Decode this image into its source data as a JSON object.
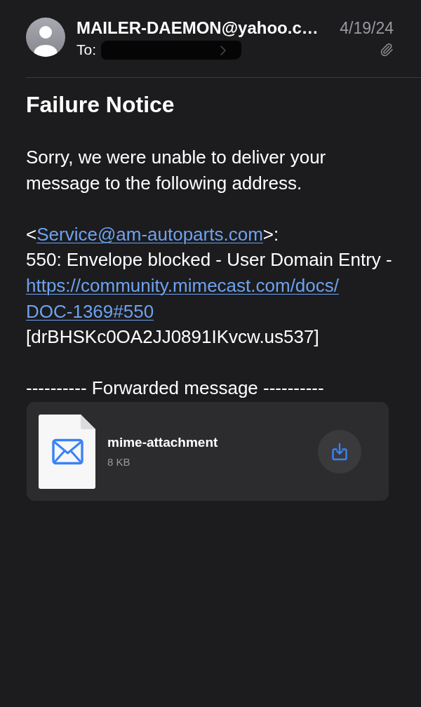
{
  "header": {
    "sender": "MAILER-DAEMON@yahoo.c…",
    "date": "4/19/24",
    "to": {
      "label": "To:",
      "redacted": true
    },
    "has_attachment": true
  },
  "subject": "Failure Notice",
  "body": [
    {
      "lines": [
        {
          "kind": "text",
          "text": "Sorry, we were unable to deliver your message to the following address."
        }
      ]
    },
    {
      "lines": [
        {
          "kind": "address",
          "prefix": "<",
          "link": "Service@am-autoparts.com",
          "suffix": ">:"
        },
        {
          "kind": "text",
          "text": "550: Envelope blocked - User Domain Entry -"
        },
        {
          "kind": "link",
          "text": "https://community.mimecast.com/docs/DOC-1369#550"
        },
        {
          "kind": "text",
          "text": "[drBHSKc0OA2JJ0891IKvcw.us537]"
        }
      ]
    },
    {
      "lines": [
        {
          "kind": "separator",
          "text": "---------- Forwarded message ----------"
        }
      ]
    }
  ],
  "attachment": {
    "name": "mime-attachment",
    "size": "8 KB"
  }
}
